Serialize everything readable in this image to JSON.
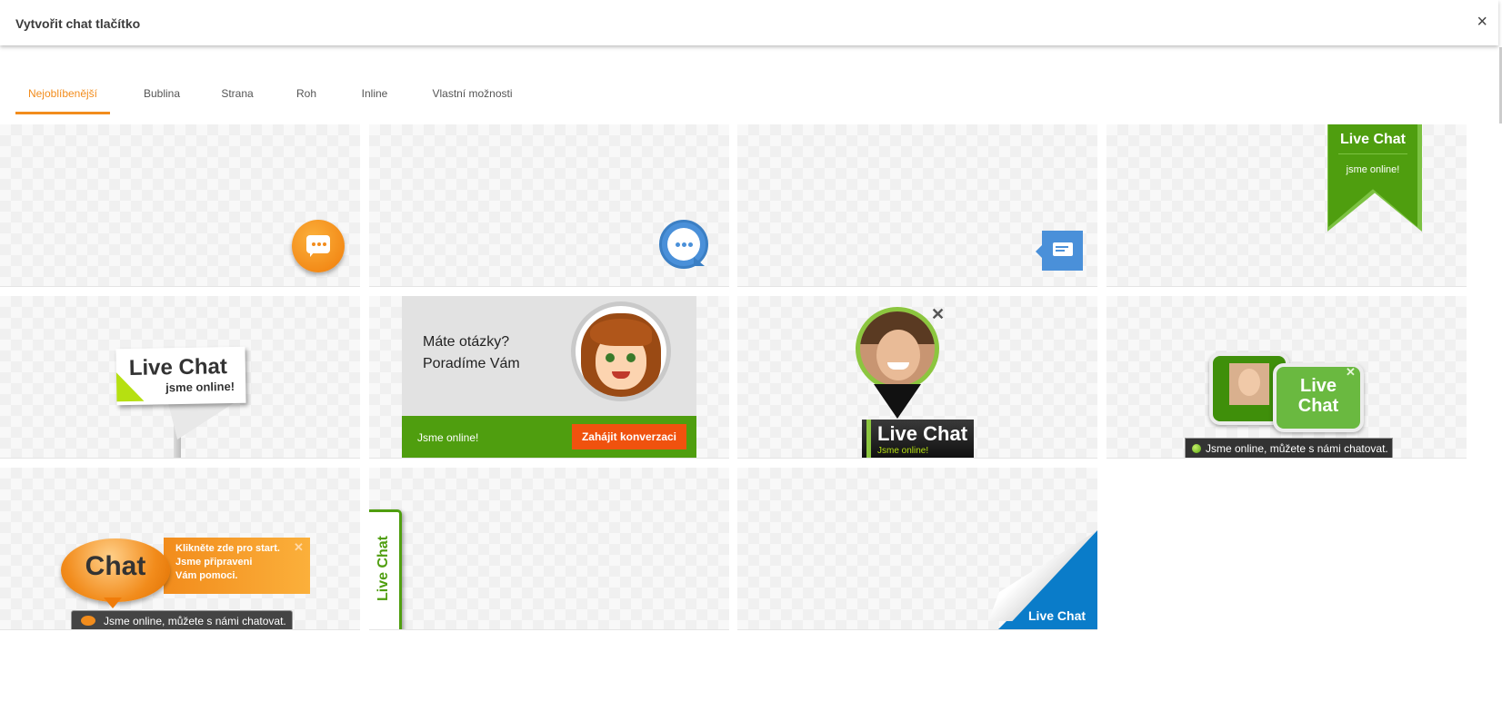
{
  "dialog": {
    "title": "Vytvořit chat tlačítko",
    "close_glyph": "×"
  },
  "tabs": [
    "Nejoblíbenější",
    "Bublina",
    "Strana",
    "Roh",
    "Inline",
    "Vlastní možnosti"
  ],
  "active_tab": "Nejoblíbenější",
  "accent_color": "#f28c1c",
  "buttons": {
    "ribbon": {
      "title": "Live Chat",
      "subtitle": "jsme online!"
    },
    "flag": {
      "title": "Live Chat",
      "subtitle": "jsme online!"
    },
    "banner": {
      "line1": "Máte otázky?",
      "line2": "Poradíme Vám",
      "status": "Jsme online!",
      "cta": "Zahájit konverzaci"
    },
    "pin": {
      "title": "Live Chat",
      "subtitle": "Jsme online!",
      "close": "✕"
    },
    "bubbles": {
      "line1": "Live",
      "line2": "Chat",
      "status": "Jsme online, můžete s námi chatovat.",
      "close": "✕"
    },
    "orange": {
      "title": "Chat",
      "line1": "Klikněte zde pro start.",
      "line2": "Jsme připraveni",
      "line3": "Vám pomoci.",
      "status": "Jsme online, můžete s námi chatovat.",
      "close": "✕"
    },
    "side_tab": {
      "label": "Live Chat"
    },
    "corner": {
      "label": "Live Chat"
    }
  }
}
